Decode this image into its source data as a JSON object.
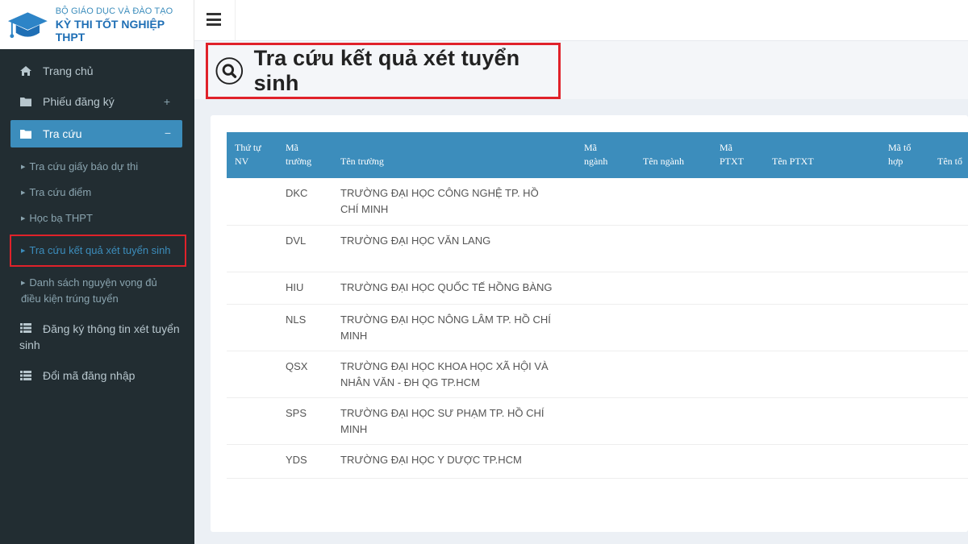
{
  "header": {
    "logo_line1": "BỘ GIÁO DỤC VÀ ĐÀO TẠO",
    "logo_line2": "KỲ THI TỐT NGHIỆP THPT"
  },
  "sidebar": {
    "items": [
      {
        "label": "Trang chủ",
        "icon": "home-icon"
      },
      {
        "label": "Phiếu đăng ký",
        "icon": "folder-icon",
        "toggle": "+"
      },
      {
        "label": "Tra cứu",
        "icon": "folder-open-icon",
        "toggle": "−"
      },
      {
        "label": "Đăng ký thông tin xét tuyển sinh",
        "icon": "list-icon"
      },
      {
        "label": "Đổi mã đăng nhập",
        "icon": "list-icon"
      }
    ],
    "subitems": [
      {
        "label": "Tra cứu giấy báo dự thi"
      },
      {
        "label": "Tra cứu điểm"
      },
      {
        "label": "Học bạ THPT"
      },
      {
        "label": "Tra cứu kết quả xét tuyển sinh"
      },
      {
        "label": "Danh sách nguyện vọng đủ điều kiện trúng tuyển"
      }
    ]
  },
  "page": {
    "title": "Tra cứu kết quả xét tuyển sinh"
  },
  "table": {
    "headers": {
      "stt_line1": "Thứ tự",
      "stt_line2": "NV",
      "ma_line1": "Mã",
      "ma_line2": "trường",
      "ten": "Tên trường",
      "mn_line1": "Mã",
      "mn_line2": "ngành",
      "tn": "Tên ngành",
      "mp_line1": "Mã",
      "mp_line2": "PTXT",
      "tp": "Tên PTXT",
      "mth_line1": "Mã tổ",
      "mth_line2": "hợp",
      "tth": "Tên tổ"
    },
    "rows": [
      {
        "code": "DKC",
        "name": "TRƯỜNG ĐẠI HỌC CÔNG NGHỆ TP. HỒ CHÍ MINH"
      },
      {
        "code": "DVL",
        "name": "TRƯỜNG ĐẠI HỌC VĂN LANG"
      },
      {
        "code": "HIU",
        "name": "TRƯỜNG ĐẠI HỌC QUỐC TẾ HỒNG BÀNG"
      },
      {
        "code": "NLS",
        "name": "TRƯỜNG ĐẠI HỌC NÔNG LÂM TP. HỒ CHÍ MINH"
      },
      {
        "code": "QSX",
        "name": "TRƯỜNG ĐẠI HỌC KHOA HỌC XÃ HỘI VÀ NHÂN VĂN - ĐH QG TP.HCM"
      },
      {
        "code": "SPS",
        "name": "TRƯỜNG ĐẠI HỌC SƯ PHẠM TP. HỒ CHÍ MINH"
      },
      {
        "code": "YDS",
        "name": "TRƯỜNG ĐẠI HỌC Y DƯỢC TP.HCM"
      }
    ]
  },
  "colors": {
    "sidebar_bg": "#222d32",
    "accent": "#3c8dbc",
    "highlight_border": "#e0222a"
  }
}
